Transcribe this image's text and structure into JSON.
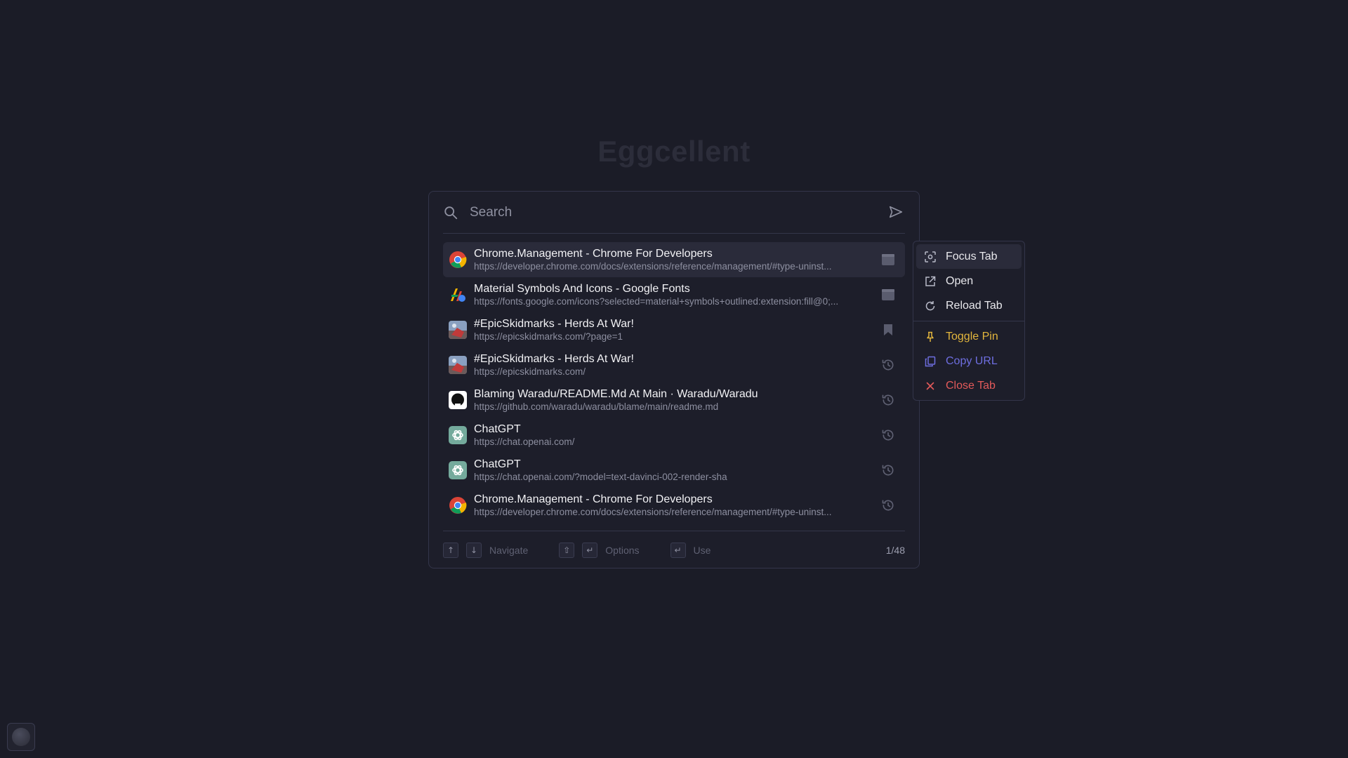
{
  "app": {
    "title": "Eggcellent"
  },
  "search": {
    "placeholder": "Search",
    "value": ""
  },
  "results": [
    {
      "title": "Chrome.Management - Chrome For Developers",
      "url": "https://developer.chrome.com/docs/extensions/reference/management/#type-uninst...",
      "favicon": "chrome-icon",
      "action": "tab-icon",
      "selected": true
    },
    {
      "title": "Material Symbols And Icons - Google Fonts",
      "url": "https://fonts.google.com/icons?selected=material+symbols+outlined:extension:fill@0;...",
      "favicon": "google-fonts-icon",
      "action": "tab-icon"
    },
    {
      "title": "#EpicSkidmarks - Herds At War!",
      "url": "https://epicskidmarks.com/?page=1",
      "favicon": "epicskidmarks-icon",
      "action": "bookmark-icon"
    },
    {
      "title": "#EpicSkidmarks - Herds At War!",
      "url": "https://epicskidmarks.com/",
      "favicon": "epicskidmarks-icon",
      "action": "history-icon"
    },
    {
      "title": "Blaming Waradu/README.Md At Main · Waradu/Waradu",
      "url": "https://github.com/waradu/waradu/blame/main/readme.md",
      "favicon": "github-icon",
      "action": "history-icon"
    },
    {
      "title": "ChatGPT",
      "url": "https://chat.openai.com/",
      "favicon": "openai-icon",
      "action": "history-icon"
    },
    {
      "title": "ChatGPT",
      "url": "https://chat.openai.com/?model=text-davinci-002-render-sha",
      "favicon": "openai-icon",
      "action": "history-icon"
    },
    {
      "title": "Chrome.Management - Chrome For Developers",
      "url": "https://developer.chrome.com/docs/extensions/reference/management/#type-uninst...",
      "favicon": "chrome-icon",
      "action": "history-icon"
    }
  ],
  "footer": {
    "navigate_label": "Navigate",
    "options_label": "Options",
    "use_label": "Use",
    "keys": {
      "up": "↑",
      "down": "↓",
      "shift": "⇧",
      "enter": "↵"
    },
    "counter": "1/48"
  },
  "context_menu": {
    "items": [
      {
        "label": "Focus Tab",
        "icon": "focus-icon"
      },
      {
        "label": "Open",
        "icon": "open-external-icon"
      },
      {
        "label": "Reload Tab",
        "icon": "reload-icon"
      },
      {
        "label": "Toggle Pin",
        "icon": "pin-icon"
      },
      {
        "label": "Copy URL",
        "icon": "copy-icon"
      },
      {
        "label": "Close Tab",
        "icon": "close-icon"
      }
    ]
  },
  "colors": {
    "background": "#1b1c27",
    "panel": "#1d1e2a",
    "selected_row": "#2a2b3a",
    "warning": "#e3b63d",
    "accent": "#6e6ee0",
    "danger": "#e35a5a"
  }
}
